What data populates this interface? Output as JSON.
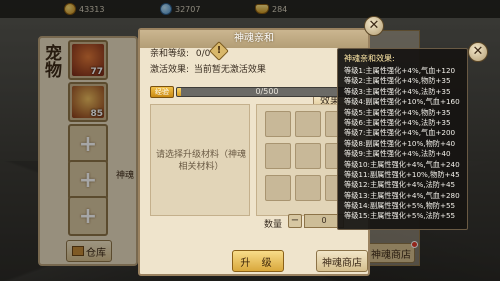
{
  "resources": [
    {
      "icon": "gold-coin-icon",
      "value": "43313"
    },
    {
      "icon": "coin-icon",
      "value": "32707"
    },
    {
      "icon": "gold-ingot-icon",
      "value": "284"
    }
  ],
  "left_panel": {
    "title": "宠物",
    "pets": [
      {
        "level": "77"
      },
      {
        "level": "85"
      }
    ],
    "warehouse_label": "仓库"
  },
  "behind": {
    "left_label": "神魂",
    "shop_label": "神魂商店"
  },
  "dialog": {
    "title": "神魂亲和",
    "affinity_label": "亲和等级:",
    "affinity_value": "0/0",
    "warn_icon_text": "!",
    "activation_label": "激活效果:",
    "activation_value": "当前暂无激活效果",
    "effect_button": "效果",
    "progress_label": "经验",
    "progress_text": "0/500",
    "progress_fraction": 0.02,
    "material_hint": "请选择升级材料（神魂相关材料）",
    "quantity_label": "数量",
    "quantity_value": "0",
    "upgrade_button": "升 级",
    "shop_button": "神魂商店"
  },
  "tooltip": {
    "title": "神魂亲和效果:",
    "lines": [
      "等级1:主属性强化+4%,气血+120",
      "等级2:主属性强化+4%,物防+35",
      "等级3:主属性强化+4%,法防+35",
      "等级4:副属性强化+10%,气血+160",
      "等级5:主属性强化+4%,物防+35",
      "等级6:主属性强化+4%,法防+35",
      "等级7:主属性强化+4%,气血+200",
      "等级8:副属性强化+10%,物防+40",
      "等级9:主属性强化+4%,法防+40",
      "等级10:主属性强化+4%,气血+240",
      "等级11:副属性强化+10%,物防+45",
      "等级12:主属性强化+4%,法防+45",
      "等级13:主属性强化+4%,气血+280",
      "等级14:副属性强化+5%,物防+55",
      "等级15:主属性强化+5%,法防+55"
    ]
  }
}
